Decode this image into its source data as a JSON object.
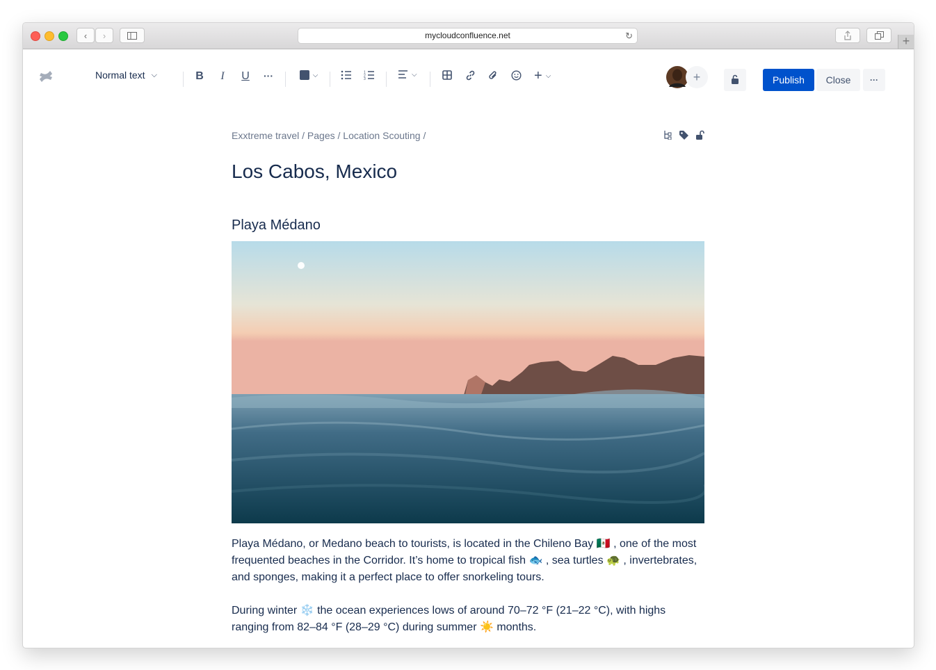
{
  "browser": {
    "url": "mycloudconfluence.net"
  },
  "editor_toolbar": {
    "text_style": "Normal text",
    "icons": [
      "bold-icon",
      "italic-icon",
      "underline-icon",
      "more-formatting-icon",
      "text-color-icon",
      "bullet-list-icon",
      "numbered-list-icon",
      "alignment-icon",
      "table-icon",
      "link-icon",
      "attachment-icon",
      "emoji-icon",
      "insert-plus-icon"
    ],
    "publish_label": "Publish",
    "close_label": "Close",
    "more_label": "···",
    "accent_color": "#0052cc"
  },
  "page": {
    "breadcrumb": "Exxtreme travel / Pages / Location Scouting /",
    "title": "Los Cabos, Mexico",
    "section_heading": "Playa Médano",
    "paragraph1": "Playa Médano, or Medano beach to tourists, is located in the Chileno Bay 🇲🇽 , one of the most frequented beaches in the Corridor. It’s home to tropical fish 🐟 , sea turtles 🐢 , invertebrates, and sponges, making it a perfect place to offer snorkeling tours.",
    "paragraph2": "During winter ❄️ the ocean experiences lows of around 70–72 °F (21–22 °C), with highs ranging from 82–84 °F (28–29 °C) during summer ☀️ months."
  }
}
